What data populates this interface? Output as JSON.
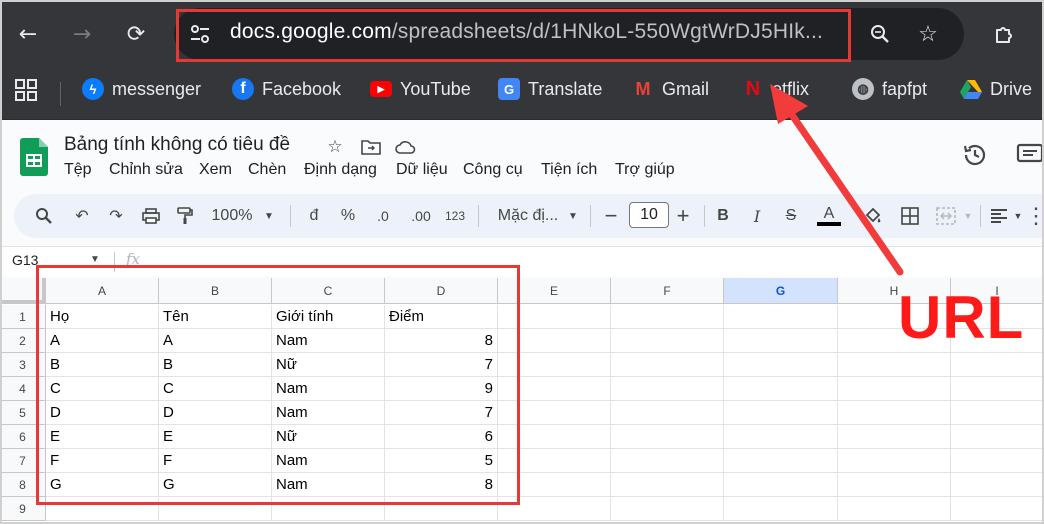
{
  "browser": {
    "url_host": "docs.google.com",
    "url_path": "/spreadsheets/d/1HNkoL-550WgtWrDJ5HIk...",
    "bookmarks": [
      {
        "label": "messenger",
        "icon": "messenger-icon",
        "color": "#0a7cff"
      },
      {
        "label": "Facebook",
        "icon": "facebook-icon",
        "color": "#1877f2"
      },
      {
        "label": "YouTube",
        "icon": "youtube-icon",
        "color": "#ff0000"
      },
      {
        "label": "Translate",
        "icon": "translate-icon",
        "color": "#4285f4"
      },
      {
        "label": "Gmail",
        "icon": "gmail-icon",
        "color": "#ea4335"
      },
      {
        "label": "etflix",
        "icon": "netflix-icon",
        "color": "#e50914"
      },
      {
        "label": "fapfpt",
        "icon": "globe-icon",
        "color": "#bdc1c6"
      },
      {
        "label": "Drive",
        "icon": "drive-icon",
        "color": "#1fa463"
      }
    ]
  },
  "sheets": {
    "title": "Bảng tính không có tiêu đề",
    "menu": [
      "Tệp",
      "Chỉnh sửa",
      "Xem",
      "Chèn",
      "Định dạng",
      "Dữ liệu",
      "Công cụ",
      "Tiện ích",
      "Trợ giúp"
    ],
    "toolbar": {
      "zoom": "100%",
      "currency": "đ",
      "percent": "%",
      "dec_decrease": ".0",
      "dec_increase": ".00",
      "number_format": "123",
      "font": "Mặc đị...",
      "font_size": "10",
      "bold": "B",
      "italic": "I"
    },
    "namebox": "G13",
    "fx": "fx"
  },
  "grid": {
    "columns": [
      "A",
      "B",
      "C",
      "D",
      "E",
      "F",
      "G",
      "H",
      "I"
    ],
    "selected_column": "G",
    "rows": [
      {
        "n": "1",
        "cells": [
          "Họ",
          "Tên",
          "Giới tính",
          "Điểm"
        ]
      },
      {
        "n": "2",
        "cells": [
          "A",
          "A",
          "Nam",
          "8"
        ]
      },
      {
        "n": "3",
        "cells": [
          "B",
          "B",
          "Nữ",
          "7"
        ]
      },
      {
        "n": "4",
        "cells": [
          "C",
          "C",
          "Nam",
          "9"
        ]
      },
      {
        "n": "5",
        "cells": [
          "D",
          "D",
          "Nam",
          "7"
        ]
      },
      {
        "n": "6",
        "cells": [
          "E",
          "E",
          "Nữ",
          "6"
        ]
      },
      {
        "n": "7",
        "cells": [
          "F",
          "F",
          "Nam",
          "5"
        ]
      },
      {
        "n": "8",
        "cells": [
          "G",
          "G",
          "Nam",
          "8"
        ]
      },
      {
        "n": "9",
        "cells": [
          "",
          "",
          "",
          ""
        ]
      }
    ]
  },
  "annotation": {
    "label": "URL",
    "color": "#e53935"
  }
}
